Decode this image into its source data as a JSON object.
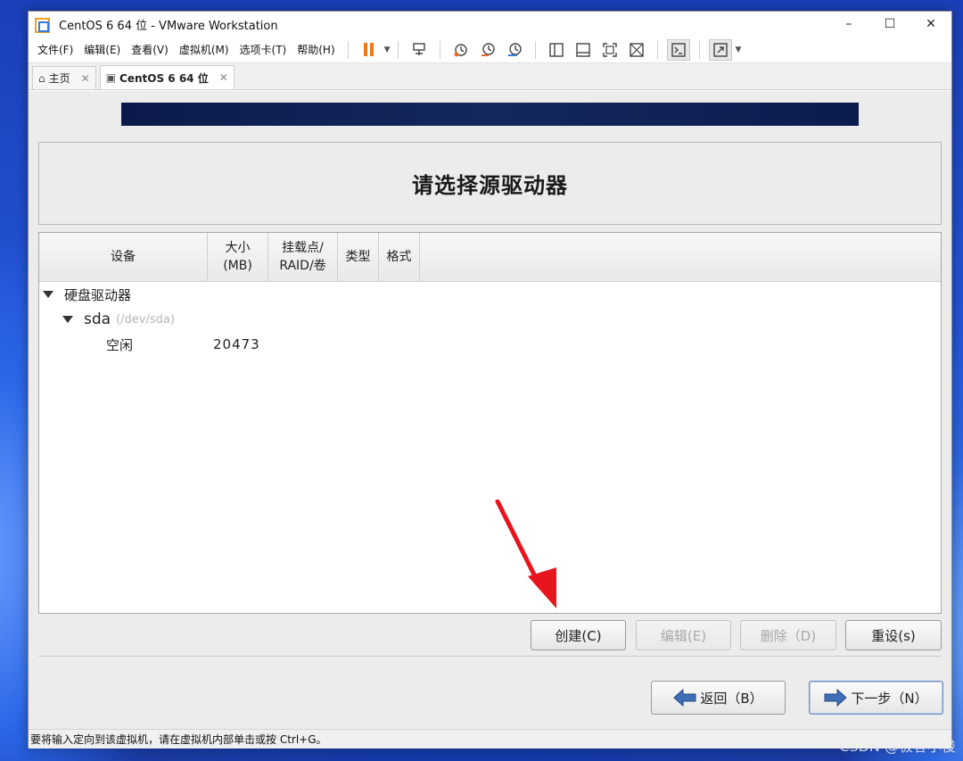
{
  "window": {
    "title": "CentOS 6 64 位 - VMware Workstation",
    "controls": {
      "minimize": "–",
      "maximize": "☐",
      "close": "✕"
    }
  },
  "menubar": {
    "items": [
      "文件(F)",
      "编辑(E)",
      "查看(V)",
      "虚拟机(M)",
      "选项卡(T)",
      "帮助(H)"
    ]
  },
  "tabs": [
    {
      "label": "主页",
      "close": "✕",
      "icon": "home-icon"
    },
    {
      "label": "CentOS 6 64 位",
      "close": "✕",
      "icon": "vm-icon"
    }
  ],
  "installer": {
    "title": "请选择源驱动器",
    "columns": {
      "device": "设备",
      "size": "大小\n(MB)",
      "mount": "挂载点/\nRAID/卷",
      "type": "类型",
      "format": "格式"
    },
    "tree": {
      "group_label": "硬盘驱动器",
      "disk_name": "sda",
      "disk_path": "(/dev/sda)",
      "free_label": "空闲",
      "free_size": "20473"
    },
    "buttons": {
      "create": "创建(C)",
      "edit": "编辑(E)",
      "delete": "删除（D)",
      "reset": "重设(s)",
      "back": "返回（B）",
      "next": "下一步（N）"
    }
  },
  "statusbar": {
    "text": "要将输入定向到该虚拟机，请在虚拟机内部单击或按 Ctrl+G。"
  },
  "watermark": "CSDN @极客小俊",
  "colors": {
    "accent_orange": "#f07818",
    "banner": "#0b1a4a",
    "annotation_red": "#e8141e"
  }
}
